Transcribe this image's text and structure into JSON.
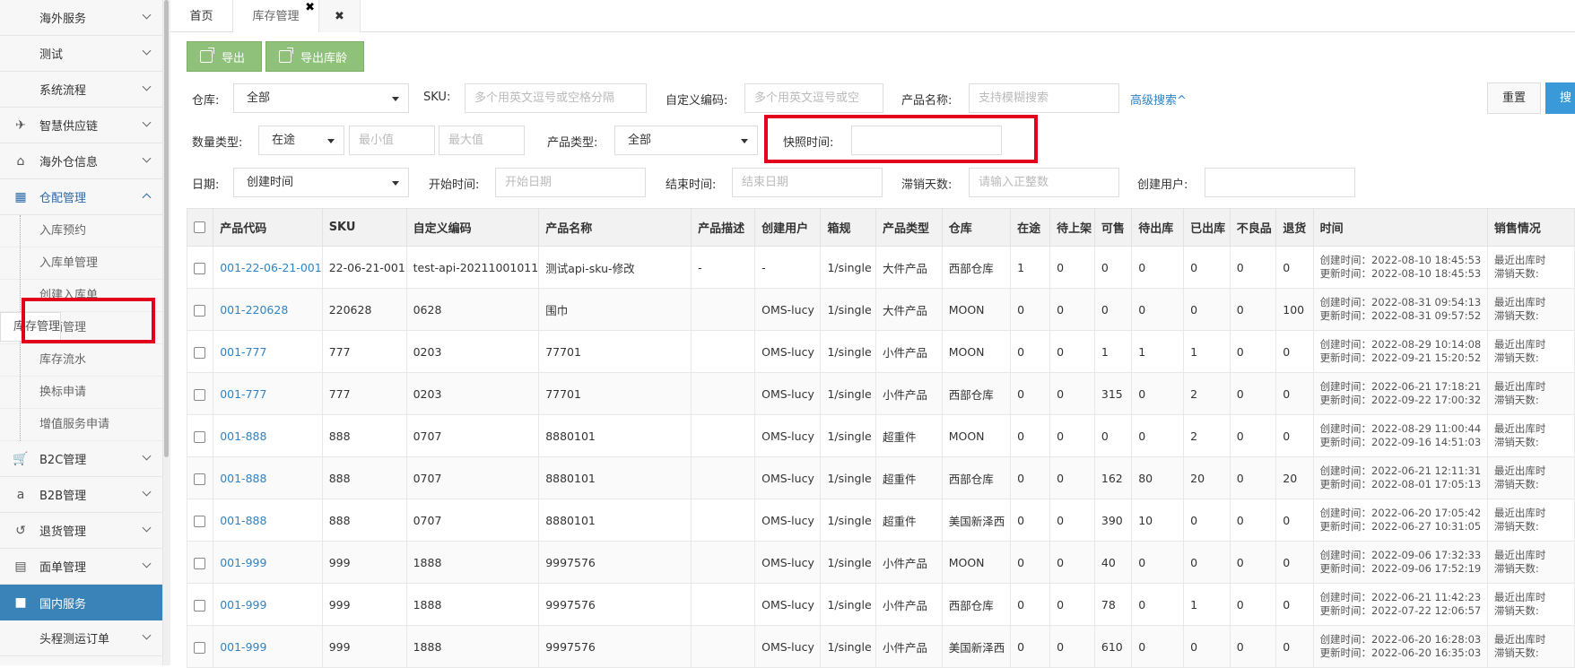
{
  "sidebar": {
    "items_top": [
      {
        "label": "海外服务"
      },
      {
        "label": "测试"
      },
      {
        "label": "系统流程"
      }
    ],
    "items_icon": [
      {
        "label": "智慧供应链",
        "icon": "plane-icon"
      },
      {
        "label": "海外仓信息",
        "icon": "home-icon"
      }
    ],
    "open_group": {
      "label": "仓配管理",
      "icon": "grid-icon"
    },
    "sub_items": [
      {
        "label": "入库预约"
      },
      {
        "label": "入库单管理"
      },
      {
        "label": "创建入库单"
      },
      {
        "label": "库存管理"
      },
      {
        "label": "拆箱管理"
      },
      {
        "label": "库存流水"
      },
      {
        "label": "换标申请"
      },
      {
        "label": "增值服务申请"
      }
    ],
    "items_bottom": [
      {
        "label": "B2C管理",
        "icon": "cart-icon"
      },
      {
        "label": "B2B管理",
        "icon": "amazon-icon"
      },
      {
        "label": "退货管理",
        "icon": "undo-icon"
      },
      {
        "label": "面单管理",
        "icon": "document-icon"
      }
    ],
    "active_item": {
      "label": "国内服务",
      "icon": "folder-icon"
    },
    "cut_item": {
      "label": "头程测运订单"
    }
  },
  "tabs": {
    "home": "首页",
    "current": "库存管理",
    "close_symbol": "✖",
    "current_close": "✖"
  },
  "toolbar": {
    "export": "导出",
    "export_age": "导出库龄"
  },
  "filters": {
    "warehouse_label": "仓库:",
    "warehouse_value": "全部",
    "sku_label": "SKU:",
    "sku_placeholder": "多个用英文逗号或空格分隔",
    "custom_code_label": "自定义编码:",
    "custom_code_placeholder": "多个用英文逗号或空",
    "product_name_label": "产品名称:",
    "product_name_placeholder": "支持模糊搜索",
    "advanced": "高级搜索^",
    "reset": "重置",
    "search": "搜索",
    "qty_type_label": "数量类型:",
    "qty_type_value": "在途",
    "min_placeholder": "最小值",
    "max_placeholder": "最大值",
    "product_type_label": "产品类型:",
    "product_type_value": "全部",
    "snapshot_label": "快照时间:",
    "snapshot_value": "",
    "date_label": "日期:",
    "date_value": "创建时间",
    "start_label": "开始时间:",
    "start_placeholder": "开始日期",
    "end_label": "结束时间:",
    "end_placeholder": "结束日期",
    "slow_days_label": "滞销天数:",
    "slow_days_placeholder": "请输入正整数",
    "creator_label": "创建用户:",
    "creator_value": ""
  },
  "table": {
    "headers": [
      "产品代码",
      "SKU",
      "自定义编码",
      "产品名称",
      "产品描述",
      "创建用户",
      "箱规",
      "产品类型",
      "仓库",
      "在途",
      "待上架",
      "可售",
      "待出库",
      "已出库",
      "不良品",
      "退货",
      "时间",
      "销售情况"
    ],
    "rows": [
      {
        "code": "001-22-06-21-001",
        "sku": "22-06-21-001",
        "custom": "test-api-20211001011",
        "name": "测试api-sku-修改",
        "desc": "-",
        "user": "-",
        "box": "1/single",
        "ptype": "大件产品",
        "wh": "西部仓库",
        "transit": "1",
        "pending": "0",
        "sellable": "0",
        "outbound_pending": "0",
        "shipped": "0",
        "defective": "0",
        "returned": "0",
        "created": "创建时间：2022-08-10 18:45:53",
        "updated": "更新时间：2022-08-10 18:45:53",
        "sales1": "最近出库时",
        "sales2": "滞销天数:"
      },
      {
        "code": "001-220628",
        "sku": "220628",
        "custom": "0628",
        "name": "围巾",
        "desc": "",
        "user": "OMS-lucy",
        "box": "1/single",
        "ptype": "大件产品",
        "wh": "MOON",
        "transit": "0",
        "pending": "0",
        "sellable": "0",
        "outbound_pending": "0",
        "shipped": "0",
        "defective": "0",
        "returned": "100",
        "created": "创建时间：2022-08-31 09:54:13",
        "updated": "更新时间：2022-08-31 09:57:52",
        "sales1": "最近出库时",
        "sales2": "滞销天数:"
      },
      {
        "code": "001-777",
        "sku": "777",
        "custom": "0203",
        "name": "77701",
        "desc": "",
        "user": "OMS-lucy",
        "box": "1/single",
        "ptype": "小件产品",
        "wh": "MOON",
        "transit": "0",
        "pending": "0",
        "sellable": "1",
        "outbound_pending": "1",
        "shipped": "1",
        "defective": "0",
        "returned": "0",
        "created": "创建时间：2022-08-29 10:14:08",
        "updated": "更新时间：2022-09-21 15:20:52",
        "sales1": "最近出库时",
        "sales2": "滞销天数:"
      },
      {
        "code": "001-777",
        "sku": "777",
        "custom": "0203",
        "name": "77701",
        "desc": "",
        "user": "OMS-lucy",
        "box": "1/single",
        "ptype": "小件产品",
        "wh": "西部仓库",
        "transit": "0",
        "pending": "0",
        "sellable": "315",
        "outbound_pending": "0",
        "shipped": "2",
        "defective": "0",
        "returned": "0",
        "created": "创建时间：2022-06-21 17:18:21",
        "updated": "更新时间：2022-09-22 17:00:32",
        "sales1": "最近出库时",
        "sales2": "滞销天数:"
      },
      {
        "code": "001-888",
        "sku": "888",
        "custom": "0707",
        "name": "8880101",
        "desc": "",
        "user": "OMS-lucy",
        "box": "1/single",
        "ptype": "超重件",
        "wh": "MOON",
        "transit": "0",
        "pending": "0",
        "sellable": "0",
        "outbound_pending": "0",
        "shipped": "2",
        "defective": "0",
        "returned": "0",
        "created": "创建时间：2022-08-29 11:00:44",
        "updated": "更新时间：2022-09-16 14:51:03",
        "sales1": "最近出库时",
        "sales2": "滞销天数:"
      },
      {
        "code": "001-888",
        "sku": "888",
        "custom": "0707",
        "name": "8880101",
        "desc": "",
        "user": "OMS-lucy",
        "box": "1/single",
        "ptype": "超重件",
        "wh": "西部仓库",
        "transit": "0",
        "pending": "0",
        "sellable": "162",
        "outbound_pending": "80",
        "shipped": "20",
        "defective": "0",
        "returned": "20",
        "created": "创建时间：2022-06-21 12:11:31",
        "updated": "更新时间：2022-08-01 17:05:13",
        "sales1": "最近出库时",
        "sales2": "滞销天数:"
      },
      {
        "code": "001-888",
        "sku": "888",
        "custom": "0707",
        "name": "8880101",
        "desc": "",
        "user": "OMS-lucy",
        "box": "1/single",
        "ptype": "超重件",
        "wh": "美国新泽西",
        "transit": "0",
        "pending": "0",
        "sellable": "390",
        "outbound_pending": "10",
        "shipped": "0",
        "defective": "0",
        "returned": "0",
        "created": "创建时间：2022-06-20 17:05:42",
        "updated": "更新时间：2022-06-27 10:31:05",
        "sales1": "最近出库时",
        "sales2": "滞销天数:"
      },
      {
        "code": "001-999",
        "sku": "999",
        "custom": "1888",
        "name": "9997576",
        "desc": "",
        "user": "OMS-lucy",
        "box": "1/single",
        "ptype": "小件产品",
        "wh": "MOON",
        "transit": "0",
        "pending": "0",
        "sellable": "40",
        "outbound_pending": "0",
        "shipped": "0",
        "defective": "0",
        "returned": "0",
        "created": "创建时间：2022-09-06 17:32:33",
        "updated": "更新时间：2022-09-06 17:52:19",
        "sales1": "最近出库时",
        "sales2": "滞销天数:"
      },
      {
        "code": "001-999",
        "sku": "999",
        "custom": "1888",
        "name": "9997576",
        "desc": "",
        "user": "OMS-lucy",
        "box": "1/single",
        "ptype": "小件产品",
        "wh": "西部仓库",
        "transit": "0",
        "pending": "0",
        "sellable": "78",
        "outbound_pending": "0",
        "shipped": "1",
        "defective": "0",
        "returned": "0",
        "created": "创建时间：2022-06-21 11:42:23",
        "updated": "更新时间：2022-07-22 12:06:57",
        "sales1": "最近出库时",
        "sales2": "滞销天数:"
      },
      {
        "code": "001-999",
        "sku": "999",
        "custom": "1888",
        "name": "9997576",
        "desc": "",
        "user": "OMS-lucy",
        "box": "1/single",
        "ptype": "小件产品",
        "wh": "美国新泽西",
        "transit": "0",
        "pending": "0",
        "sellable": "610",
        "outbound_pending": "0",
        "shipped": "0",
        "defective": "0",
        "returned": "0",
        "created": "创建时间：2022-06-20 16:28:03",
        "updated": "更新时间：2022-06-20 16:35:03",
        "sales1": "最近出库时",
        "sales2": "滞销天数:"
      }
    ]
  },
  "colors": {
    "accent": "#3a83b8",
    "green": "#8fc17b",
    "link": "#2c84c8",
    "highlight": "#e3001b"
  }
}
